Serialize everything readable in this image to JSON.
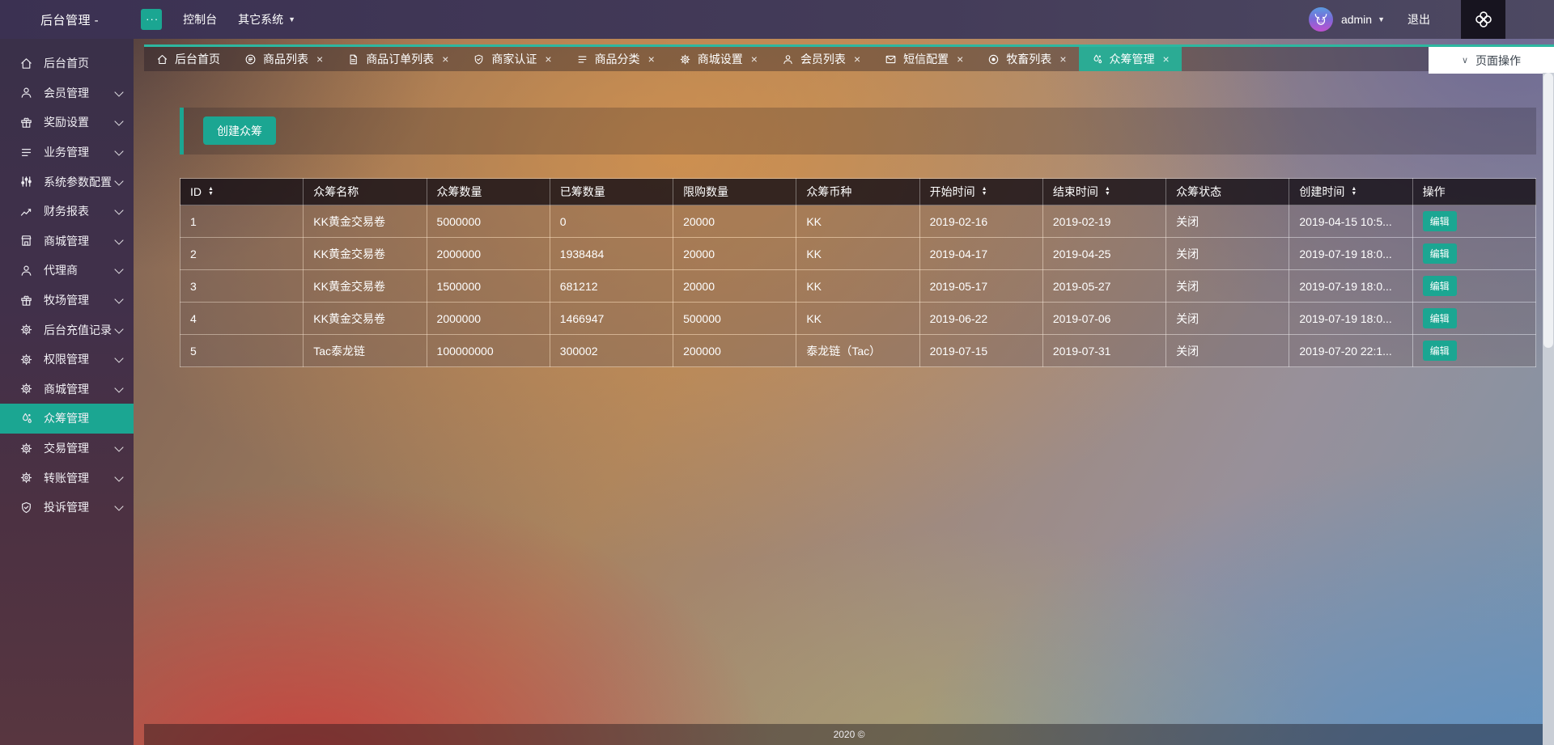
{
  "colors": {
    "accent": "#1ba692",
    "tab_active": "#2bab94"
  },
  "topbar": {
    "title": "后台管理 -",
    "menu_toggle_icon": "ellipsis-icon",
    "nav": [
      {
        "label": "控制台",
        "has_dropdown": false
      },
      {
        "label": "其它系统",
        "has_dropdown": true
      }
    ],
    "user": {
      "name": "admin",
      "avatar_icon": "ox-icon"
    },
    "logout_label": "退出",
    "corner_icon": "knot-icon"
  },
  "sidebar": {
    "items": [
      {
        "id": "dashboard",
        "label": "后台首页",
        "icon": "home",
        "expandable": false,
        "active": false
      },
      {
        "id": "member-mgmt",
        "label": "会员管理",
        "icon": "user",
        "expandable": true,
        "active": false
      },
      {
        "id": "reward-settings",
        "label": "奖励设置",
        "icon": "gift",
        "expandable": true,
        "active": false
      },
      {
        "id": "business-mgmt",
        "label": "业务管理",
        "icon": "list",
        "expandable": true,
        "active": false
      },
      {
        "id": "system-params",
        "label": "系统参数配置",
        "icon": "sliders",
        "expandable": true,
        "active": false
      },
      {
        "id": "finance-reports",
        "label": "财务报表",
        "icon": "chart",
        "expandable": true,
        "active": false
      },
      {
        "id": "mall-mgmt",
        "label": "商城管理",
        "icon": "store",
        "expandable": true,
        "active": false
      },
      {
        "id": "agents",
        "label": "代理商",
        "icon": "user",
        "expandable": true,
        "active": false
      },
      {
        "id": "ranch-mgmt",
        "label": "牧场管理",
        "icon": "gift",
        "expandable": true,
        "active": false
      },
      {
        "id": "recharge-records",
        "label": "后台充值记录",
        "icon": "gear",
        "expandable": true,
        "active": false
      },
      {
        "id": "permission-mgmt",
        "label": "权限管理",
        "icon": "gear",
        "expandable": true,
        "active": false
      },
      {
        "id": "mall-mgmt-2",
        "label": "商城管理",
        "icon": "gear",
        "expandable": true,
        "active": false
      },
      {
        "id": "crowdfund-mgmt",
        "label": "众筹管理",
        "icon": "drops",
        "expandable": false,
        "active": true
      },
      {
        "id": "trade-mgmt",
        "label": "交易管理",
        "icon": "gear",
        "expandable": true,
        "active": false
      },
      {
        "id": "transfer-mgmt",
        "label": "转账管理",
        "icon": "gear",
        "expandable": true,
        "active": false
      },
      {
        "id": "complaint-mgmt",
        "label": "投诉管理",
        "icon": "shield-check",
        "expandable": true,
        "active": false
      }
    ]
  },
  "tabs": {
    "items": [
      {
        "id": "home",
        "label": "后台首页",
        "icon": "home",
        "closable": false,
        "active": false
      },
      {
        "id": "product-list",
        "label": "商品列表",
        "icon": "list-circle",
        "closable": true,
        "active": false
      },
      {
        "id": "product-orders",
        "label": "商品订单列表",
        "icon": "doc",
        "closable": true,
        "active": false
      },
      {
        "id": "merchant-auth",
        "label": "商家认证",
        "icon": "shield-check",
        "closable": true,
        "active": false
      },
      {
        "id": "product-category",
        "label": "商品分类",
        "icon": "list",
        "closable": true,
        "active": false
      },
      {
        "id": "mall-settings",
        "label": "商城设置",
        "icon": "gear",
        "closable": true,
        "active": false
      },
      {
        "id": "member-list",
        "label": "会员列表",
        "icon": "user",
        "closable": true,
        "active": false
      },
      {
        "id": "sms-config",
        "label": "短信配置",
        "icon": "mail",
        "closable": true,
        "active": false
      },
      {
        "id": "livestock-list",
        "label": "牧畜列表",
        "icon": "target",
        "closable": true,
        "active": false
      },
      {
        "id": "crowdfund-mgmt",
        "label": "众筹管理",
        "icon": "drops",
        "closable": true,
        "active": true
      }
    ],
    "page_actions_label": "页面操作"
  },
  "toolbar": {
    "create_button_label": "创建众筹"
  },
  "table": {
    "columns": [
      {
        "id": "id",
        "label": "ID",
        "sortable": true
      },
      {
        "id": "name",
        "label": "众筹名称",
        "sortable": false
      },
      {
        "id": "target-amount",
        "label": "众筹数量",
        "sortable": false
      },
      {
        "id": "raised-amount",
        "label": "已筹数量",
        "sortable": false
      },
      {
        "id": "purchase-limit",
        "label": "限购数量",
        "sortable": false
      },
      {
        "id": "currency",
        "label": "众筹币种",
        "sortable": false
      },
      {
        "id": "start-time",
        "label": "开始时间",
        "sortable": true
      },
      {
        "id": "end-time",
        "label": "结束时间",
        "sortable": true
      },
      {
        "id": "status",
        "label": "众筹状态",
        "sortable": false
      },
      {
        "id": "created-time",
        "label": "创建时间",
        "sortable": true
      },
      {
        "id": "actions",
        "label": "操作",
        "sortable": false
      }
    ],
    "rows": [
      [
        "1",
        "KK黄金交易卷",
        "5000000",
        "0",
        "20000",
        "KK",
        "2019-02-16",
        "2019-02-19",
        "关闭",
        "2019-04-15 10:5..."
      ],
      [
        "2",
        "KK黄金交易卷",
        "2000000",
        "1938484",
        "20000",
        "KK",
        "2019-04-17",
        "2019-04-25",
        "关闭",
        "2019-07-19 18:0..."
      ],
      [
        "3",
        "KK黄金交易卷",
        "1500000",
        "681212",
        "20000",
        "KK",
        "2019-05-17",
        "2019-05-27",
        "关闭",
        "2019-07-19 18:0..."
      ],
      [
        "4",
        "KK黄金交易卷",
        "2000000",
        "1466947",
        "500000",
        "KK",
        "2019-06-22",
        "2019-07-06",
        "关闭",
        "2019-07-19 18:0..."
      ],
      [
        "5",
        "Tac泰龙链",
        "100000000",
        "300002",
        "200000",
        "泰龙链（Tac）",
        "2019-07-15",
        "2019-07-31",
        "关闭",
        "2019-07-20 22:1..."
      ]
    ],
    "edit_button_label": "编辑"
  },
  "footer": {
    "copyright": "2020 ©"
  }
}
